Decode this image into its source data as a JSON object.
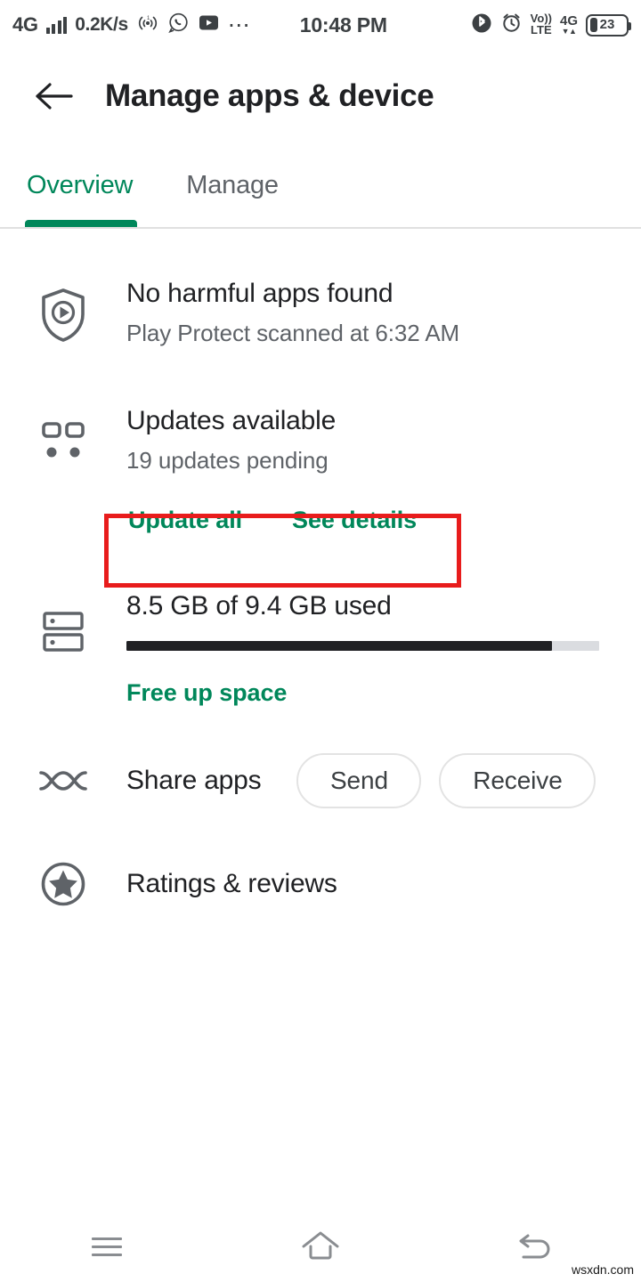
{
  "status_bar": {
    "network_type": "4G",
    "network_speed": "0.2K/s",
    "clock": "10:48 PM",
    "volte_top": "Vo))",
    "volte_bottom": "LTE",
    "data_label": "4G",
    "data_arrows": "▼▲",
    "battery_percent": "23",
    "icons": [
      "signal-bars-icon",
      "broadcast-icon",
      "whatsapp-icon",
      "youtube-icon",
      "more-icon",
      "bluetooth-icon",
      "alarm-icon",
      "volte-icon",
      "mobile-data-icon",
      "battery-icon"
    ]
  },
  "app_bar": {
    "title": "Manage apps & device",
    "back_icon": "back-arrow-icon"
  },
  "tabs": {
    "items": [
      {
        "label": "Overview",
        "active": true
      },
      {
        "label": "Manage",
        "active": false
      }
    ],
    "active_color": "#00875a",
    "inactive_color": "#5f6368"
  },
  "sections": {
    "play_protect": {
      "icon": "play-protect-shield-icon",
      "title": "No harmful apps found",
      "subtitle": "Play Protect scanned at 6:32 AM"
    },
    "updates": {
      "icon": "app-updates-grid-icon",
      "title": "Updates available",
      "subtitle": "19 updates pending",
      "update_all_label": "Update all",
      "see_details_label": "See details"
    },
    "storage": {
      "icon": "storage-icon",
      "title": "8.5 GB of 9.4 GB used",
      "used_gb": "8.5",
      "total_gb": "9.4",
      "percent_used": 90,
      "free_up_label": "Free up space"
    },
    "share_apps": {
      "icon": "share-apps-icon",
      "title": "Share apps",
      "send_label": "Send",
      "receive_label": "Receive"
    },
    "ratings": {
      "icon": "star-circle-icon",
      "title": "Ratings & reviews"
    }
  },
  "annotation": {
    "color": "#e81c1c",
    "target": "update-actions-row"
  },
  "nav_bar": {
    "recents_icon": "menu-icon",
    "home_icon": "home-icon",
    "back_icon": "back-icon"
  },
  "watermark": "wsxdn.com"
}
